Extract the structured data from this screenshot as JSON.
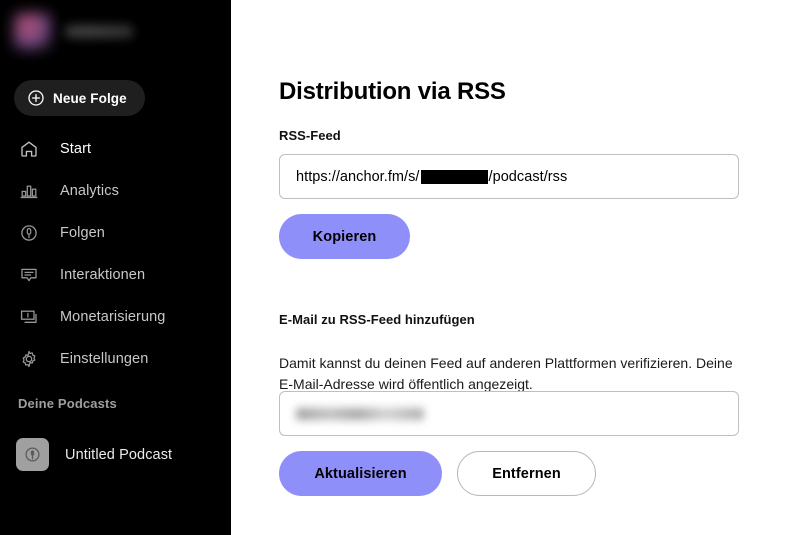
{
  "sidebar": {
    "account": {
      "avatar_icon": "user-avatar-blurred",
      "username_redacted": true
    },
    "new_episode_button": {
      "label": "Neue Folge",
      "icon": "plus-circle-icon"
    },
    "nav_items": [
      {
        "label": "Start",
        "icon": "home-icon",
        "active": true
      },
      {
        "label": "Analytics",
        "icon": "bar-chart-icon",
        "active": false
      },
      {
        "label": "Folgen",
        "icon": "microphone-icon",
        "active": false
      },
      {
        "label": "Interaktionen",
        "icon": "speech-bubble-icon",
        "active": false
      },
      {
        "label": "Monetarisierung",
        "icon": "banknotes-icon",
        "active": false
      },
      {
        "label": "Einstellungen",
        "icon": "gear-icon",
        "active": false
      }
    ],
    "podcasts_section": {
      "heading": "Deine Podcasts",
      "items": [
        {
          "name": "Untitled Podcast",
          "icon": "microphone-icon"
        }
      ]
    },
    "background_color": "#000000"
  },
  "main": {
    "page_title": "Distribution via RSS",
    "rss_section": {
      "label": "RSS-Feed",
      "url_prefix": "https://anchor.fm/s/",
      "url_redacted_segment": "",
      "url_suffix": "/podcast/rss",
      "copy_button": "Kopieren"
    },
    "email_section": {
      "label": "E-Mail zu RSS-Feed hinzufügen",
      "description": "Damit kannst du deinen Feed auf anderen Plattformen verifizieren. Deine E-Mail-Adresse wird öffentlich angezeigt.",
      "email_value_redacted": true,
      "update_button": "Aktualisieren",
      "remove_button": "Entfernen"
    }
  },
  "colors": {
    "accent_purple": "#8f8ffa",
    "sidebar_bg": "#000000",
    "page_bg": "#ffffff",
    "input_border": "#bfbfbf",
    "redaction_black": "#000000"
  }
}
